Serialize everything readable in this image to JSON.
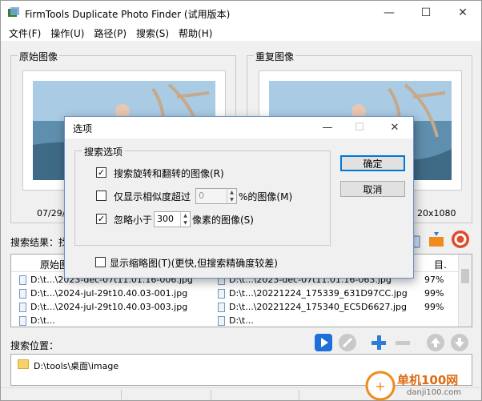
{
  "window": {
    "title": "FirmTools Duplicate Photo Finder (试用版本)",
    "minimize_glyph": "—",
    "maximize_glyph": "☐",
    "close_glyph": "✕"
  },
  "menu": {
    "items": [
      {
        "label": "文件(F)"
      },
      {
        "label": "操作(U)"
      },
      {
        "label": "路径(P)"
      },
      {
        "label": "搜索(S)"
      },
      {
        "label": "帮助(H)"
      }
    ]
  },
  "original_panel": {
    "label": "原始图像",
    "caption": "07/29/2"
  },
  "duplicate_panel": {
    "label": "重复图像",
    "caption": "20x1080"
  },
  "results": {
    "label": "搜索结果：找到",
    "columns": {
      "original": "原始图像",
      "match": "目."
    },
    "rows": [
      {
        "original": "D:\\t...\\2023-dec-07t11.01.16-006.jpg",
        "duplicate": "D:\\t...\\2023-dec-07t11.01.16-063.jpg",
        "match": "97%"
      },
      {
        "original": "D:\\t...\\2024-jul-29t10.40.03-001.jpg",
        "duplicate": "D:\\t...\\20221224_175339_631D97CC.jpg",
        "match": "99%"
      },
      {
        "original": "D:\\t...\\2024-jul-29t10.40.03-003.jpg",
        "duplicate": "D:\\t...\\20221224_175340_EC5D6627.jpg",
        "match": "99%"
      }
    ],
    "partial_row": {
      "original": "D:\\t...",
      "duplicate": "D:\\t..."
    }
  },
  "location": {
    "label": "搜索位置：",
    "paths": [
      "D:\\tools\\桌面\\image"
    ]
  },
  "dialog": {
    "title": "选项",
    "group_label": "搜索选项",
    "options": {
      "rotate": {
        "label": "搜索旋转和翻转的图像(R)",
        "checked": true
      },
      "similarity": {
        "prefix": "仅显示相似度超过",
        "value": "0",
        "suffix": "%的图像(M)",
        "checked": false
      },
      "ignore_small": {
        "prefix": "忽略小于",
        "value": "300",
        "suffix": "像素的图像(S)",
        "checked": true
      },
      "thumbnails": {
        "label": "显示缩略图(T)(更快,但搜索精确度较差)",
        "checked": false
      }
    },
    "ok_label": "确定",
    "cancel_label": "取消",
    "minimize_glyph": "—",
    "maximize_glyph": "☐",
    "close_glyph": "✕"
  },
  "watermark": {
    "text": "单机100网",
    "url": "danji100.com"
  },
  "colors": {
    "accent_blue": "#1e6fd9",
    "orange": "#f08a1c",
    "red": "#e04b2b"
  }
}
